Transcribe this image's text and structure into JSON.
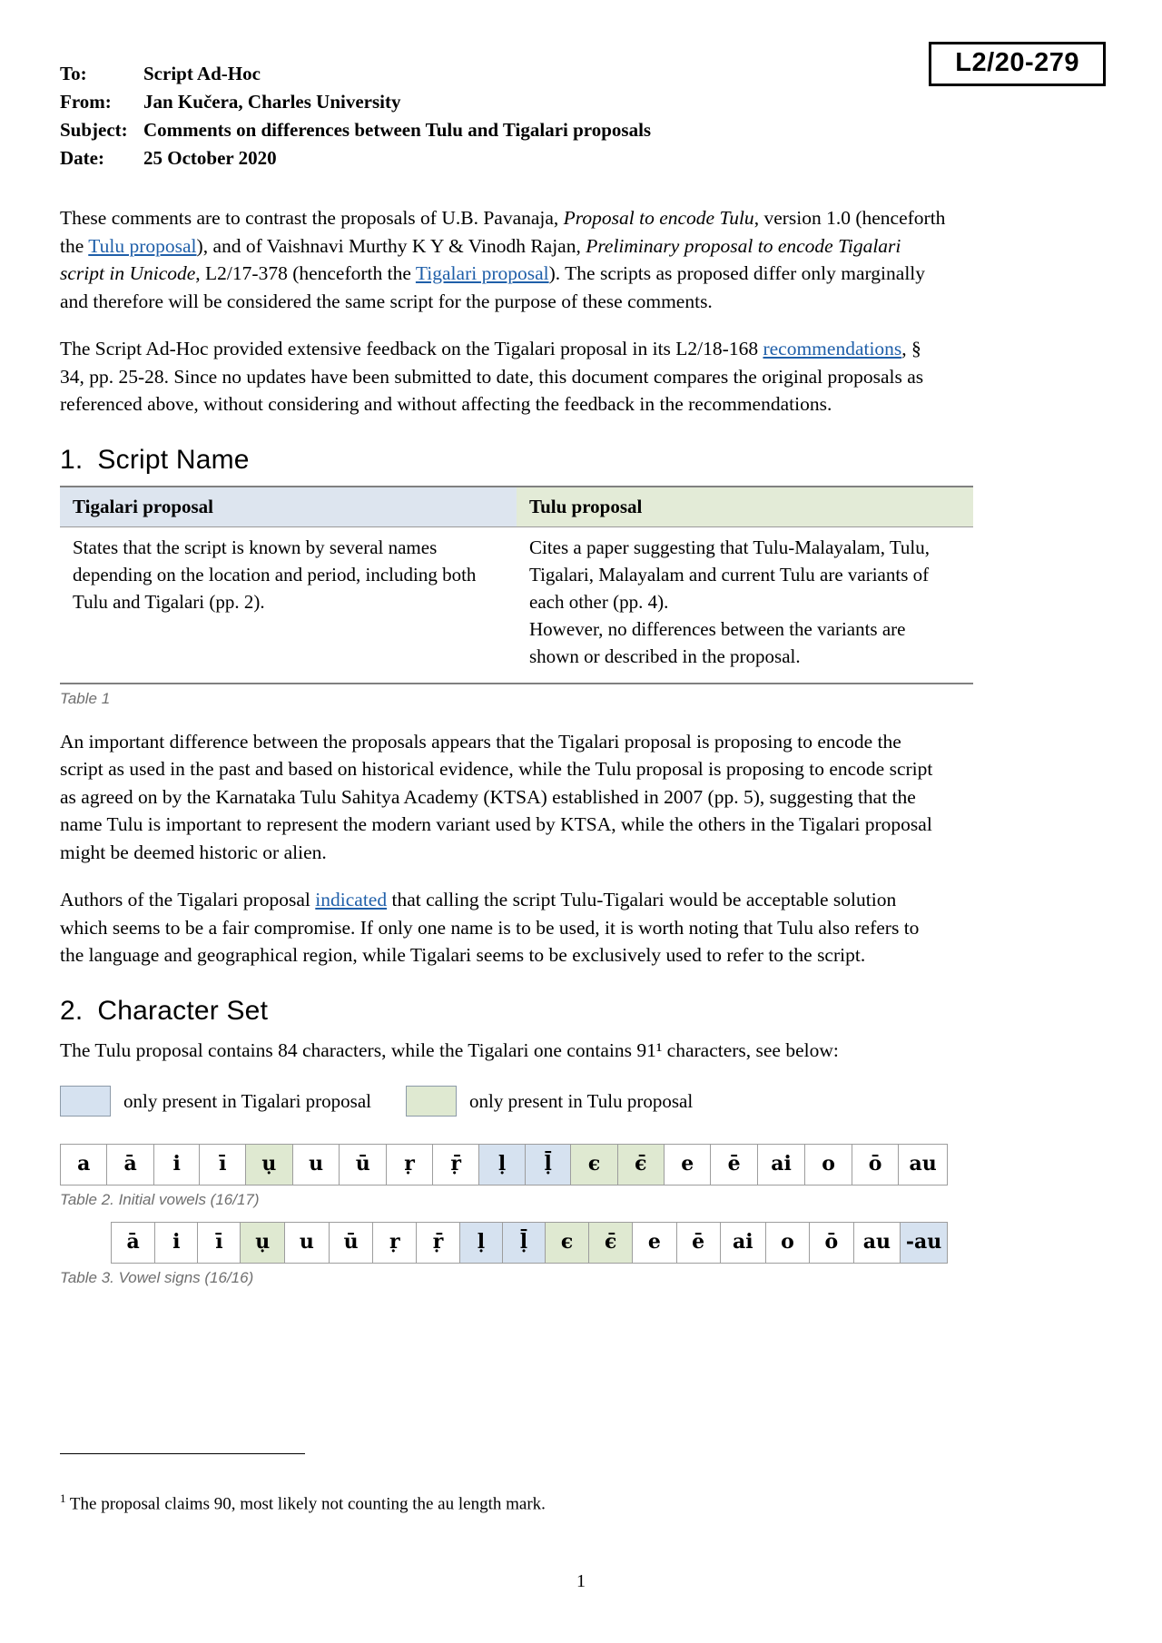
{
  "doc_number": "L2/20-279",
  "header": {
    "rows": [
      {
        "label": "To:",
        "value": "Script Ad-Hoc"
      },
      {
        "label": "From:",
        "value": "Jan Kučera, Charles University"
      },
      {
        "label": "Subject:",
        "value": "Comments on differences between Tulu and Tigalari proposals"
      },
      {
        "label": "Date:",
        "value": "25 October 2020"
      }
    ]
  },
  "paragraphs": {
    "p1": {
      "s1": "These comments are to contrast the proposals of U.B. Pavanaja, ",
      "i1": "Proposal to encode Tulu",
      "s2": ", version 1.0 (henceforth the ",
      "link1": "Tulu proposal",
      "s3": "), and of Vaishnavi Murthy K Y & Vinodh Rajan, ",
      "i2": "Preliminary proposal to encode Tigalari script in Unicode",
      "s4": ", L2/17-378 (henceforth the ",
      "link2": "Tigalari proposal",
      "s5": "). The scripts as proposed differ only marginally and therefore will be considered the same script for the purpose of these comments."
    },
    "p2": {
      "s1": "The Script Ad-Hoc provided extensive feedback on the Tigalari proposal in its L2/18-168 ",
      "link1": "recommendations",
      "s2": ", § 34, pp. 25-28. Since no updates have been submitted to date, this document compares the original proposals as referenced above, without considering and without affecting the feedback in the recommendations."
    },
    "p3": "An important difference between the proposals appears that the Tigalari proposal is proposing to encode the script as used in the past and based on historical evidence, while the Tulu proposal is proposing to encode script as agreed on by the Karnataka Tulu Sahitya Academy (KTSA) established in 2007 (pp. 5), suggesting that the name Tulu is important to represent the modern variant used by KTSA, while the others in the Tigalari proposal might be deemed historic or alien.",
    "p4": {
      "s1": "Authors of the Tigalari proposal ",
      "link1": "indicated",
      "s2": " that calling the script Tulu-Tigalari would be acceptable solution which seems to be a fair compromise. If only one name is to be used, it is worth noting that Tulu also refers to the language and geographical region, while Tigalari seems to be exclusively used to refer to the script."
    },
    "p5": "The Tulu proposal contains 84 characters, while the Tigalari one contains 91¹ characters, see below:"
  },
  "sections": {
    "s1": {
      "num": "1.",
      "title": "Script Name"
    },
    "s2": {
      "num": "2.",
      "title": "Character Set"
    }
  },
  "table1": {
    "headers": [
      "Tigalari proposal",
      "Tulu proposal"
    ],
    "row": {
      "left": "States that the script is known by several names depending on the location and period, including both Tulu and Tigalari (pp. 2).",
      "right_p1": "Cites a paper suggesting that Tulu-Malayalam, Tulu, Tigalari, Malayalam and current Tulu are variants of each other (pp. 4).",
      "right_p2": "However, no differences between the variants are shown or described in the proposal."
    },
    "caption": "Table 1"
  },
  "legend": {
    "items": [
      {
        "color": "#d6e2f0",
        "style": "blue",
        "label": "only present in Tigalari proposal"
      },
      {
        "color": "#dfe9d1",
        "style": "green",
        "label": "only present in Tulu proposal"
      }
    ]
  },
  "table2": {
    "caption": "Table 2. Initial vowels (16/17)",
    "cells": [
      {
        "ch": "a",
        "hl": "none"
      },
      {
        "ch": "ā",
        "hl": "none"
      },
      {
        "ch": "i",
        "hl": "none"
      },
      {
        "ch": "ī",
        "hl": "none"
      },
      {
        "ch": "ụ",
        "hl": "green"
      },
      {
        "ch": "u",
        "hl": "none"
      },
      {
        "ch": "ū",
        "hl": "none"
      },
      {
        "ch": "ṛ",
        "hl": "none"
      },
      {
        "ch": "ṝ",
        "hl": "none"
      },
      {
        "ch": "ḷ",
        "hl": "blue"
      },
      {
        "ch": "ḹ",
        "hl": "blue"
      },
      {
        "ch": "ϵ",
        "hl": "green"
      },
      {
        "ch": "ϵ̄",
        "hl": "green"
      },
      {
        "ch": "e",
        "hl": "none"
      },
      {
        "ch": "ē",
        "hl": "none"
      },
      {
        "ch": "ai",
        "hl": "none"
      },
      {
        "ch": "o",
        "hl": "none"
      },
      {
        "ch": "ō",
        "hl": "none"
      },
      {
        "ch": "au",
        "hl": "none"
      }
    ]
  },
  "table3": {
    "caption": "Table 3. Vowel signs (16/16)",
    "cells": [
      {
        "ch": "ā",
        "hl": "none"
      },
      {
        "ch": "i",
        "hl": "none"
      },
      {
        "ch": "ī",
        "hl": "none"
      },
      {
        "ch": "ụ",
        "hl": "green"
      },
      {
        "ch": "u",
        "hl": "none"
      },
      {
        "ch": "ū",
        "hl": "none"
      },
      {
        "ch": "ṛ",
        "hl": "none"
      },
      {
        "ch": "ṝ",
        "hl": "none"
      },
      {
        "ch": "ḷ",
        "hl": "blue"
      },
      {
        "ch": "ḹ",
        "hl": "blue"
      },
      {
        "ch": "ϵ",
        "hl": "green"
      },
      {
        "ch": "ϵ̄",
        "hl": "green"
      },
      {
        "ch": "e",
        "hl": "none"
      },
      {
        "ch": "ē",
        "hl": "none"
      },
      {
        "ch": "ai",
        "hl": "none"
      },
      {
        "ch": "o",
        "hl": "none"
      },
      {
        "ch": "ō",
        "hl": "none"
      },
      {
        "ch": "au",
        "hl": "none"
      },
      {
        "ch": "-au",
        "hl": "blue"
      }
    ]
  },
  "footnote": {
    "marker": "1",
    "text": " The proposal claims 90, most likely not counting the au length mark."
  },
  "page_number": "1"
}
